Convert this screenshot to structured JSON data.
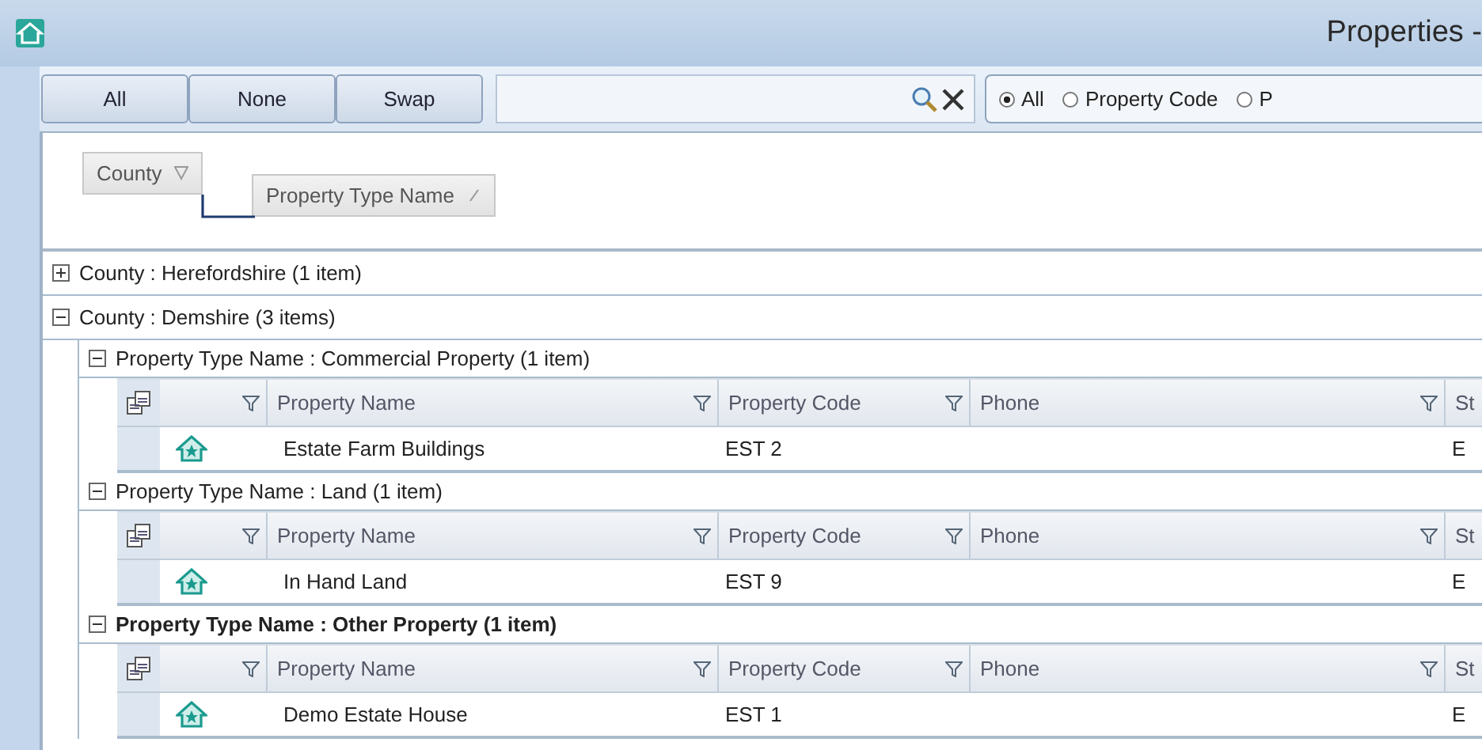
{
  "window": {
    "title": "Properties -"
  },
  "toolbar": {
    "buttons": [
      "All",
      "None",
      "Swap"
    ],
    "radios": [
      {
        "label": "All",
        "selected": true
      },
      {
        "label": "Property Code",
        "selected": false
      },
      {
        "label": "P",
        "selected": false
      }
    ]
  },
  "group_panel": [
    "County",
    "Property Type Name"
  ],
  "groups": [
    {
      "label": "County : Herefordshire (1 item)",
      "expanded": false
    },
    {
      "label": "County : Demshire (3 items)",
      "expanded": true,
      "children": [
        {
          "label": "Property Type Name : Commercial Property (1 item)",
          "expanded": true,
          "focused": false,
          "columns": [
            "Property Name",
            "Property Code",
            "Phone",
            "St"
          ],
          "rows": [
            {
              "cells": [
                "Estate Farm Buildings",
                "EST 2",
                "",
                "E"
              ]
            }
          ]
        },
        {
          "label": "Property Type Name : Land (1 item)",
          "expanded": true,
          "focused": false,
          "columns": [
            "Property Name",
            "Property Code",
            "Phone",
            "St"
          ],
          "rows": [
            {
              "cells": [
                "In Hand Land",
                "EST 9",
                "",
                "E"
              ]
            }
          ]
        },
        {
          "label": "Property Type Name : Other Property (1 item)",
          "expanded": true,
          "focused": true,
          "columns": [
            "Property Name",
            "Property Code",
            "Phone",
            "St"
          ],
          "rows": [
            {
              "cells": [
                "Demo Estate House",
                "EST 1",
                "",
                "E"
              ]
            }
          ]
        }
      ]
    }
  ]
}
